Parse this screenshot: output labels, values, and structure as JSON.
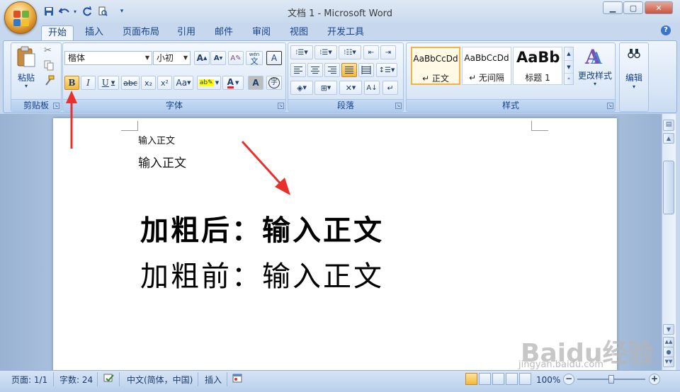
{
  "window": {
    "title": "文档 1 - Microsoft Word",
    "min_symbol": "▁",
    "max_symbol": "▢",
    "close_symbol": "✕"
  },
  "qat": {
    "more_symbol": "▾"
  },
  "tabs": [
    {
      "label": "开始"
    },
    {
      "label": "插入"
    },
    {
      "label": "页面布局"
    },
    {
      "label": "引用"
    },
    {
      "label": "邮件"
    },
    {
      "label": "审阅"
    },
    {
      "label": "视图"
    },
    {
      "label": "开发工具"
    }
  ],
  "help_symbol": "?",
  "ribbon": {
    "clipboard": {
      "label": "剪贴板",
      "paste_label": "粘贴",
      "paste_arrow": "▾"
    },
    "font": {
      "label": "字体",
      "font_name": "楷体",
      "font_size": "小初",
      "grow": "A",
      "shrink": "A",
      "bold": "B",
      "italic": "I",
      "underline": "U",
      "strike": "abc",
      "subscript": "x₂",
      "superscript": "x²",
      "case": "Aa",
      "phonetic": "wén",
      "phonetic_char": "文",
      "border_char": "A",
      "color_char": "A",
      "shade_char": "A",
      "enclose_char": "字"
    },
    "paragraph": {
      "label": "段落"
    },
    "styles": {
      "label": "样式",
      "items": [
        {
          "preview": "AaBbCcDd",
          "name": "↵ 正文"
        },
        {
          "preview": "AaBbCcDd",
          "name": "↵ 无间隔"
        },
        {
          "preview": "AaBb",
          "name": "标题 1"
        }
      ],
      "change_styles": "更改样式",
      "change_arrow": "▾"
    },
    "editing": {
      "label": "编辑",
      "arrow": "▾"
    }
  },
  "document": {
    "line1": "输入正文",
    "line2": "输入正文",
    "bold_line": "加粗后：输入正文",
    "normal_line": "加粗前：输入正文"
  },
  "status": {
    "page": "页面: 1/1",
    "words": "字数: 24",
    "language": "中文(简体，中国)",
    "mode": "插入",
    "zoom": "100%",
    "zoom_minus": "−",
    "zoom_plus": "+"
  },
  "watermark": {
    "text": "Baidu经验",
    "sub": "jingyan.baidu.com"
  },
  "colors": {
    "accent": "#15428b",
    "annotation": "#e8312c",
    "bold_active": "#f5b63c"
  }
}
